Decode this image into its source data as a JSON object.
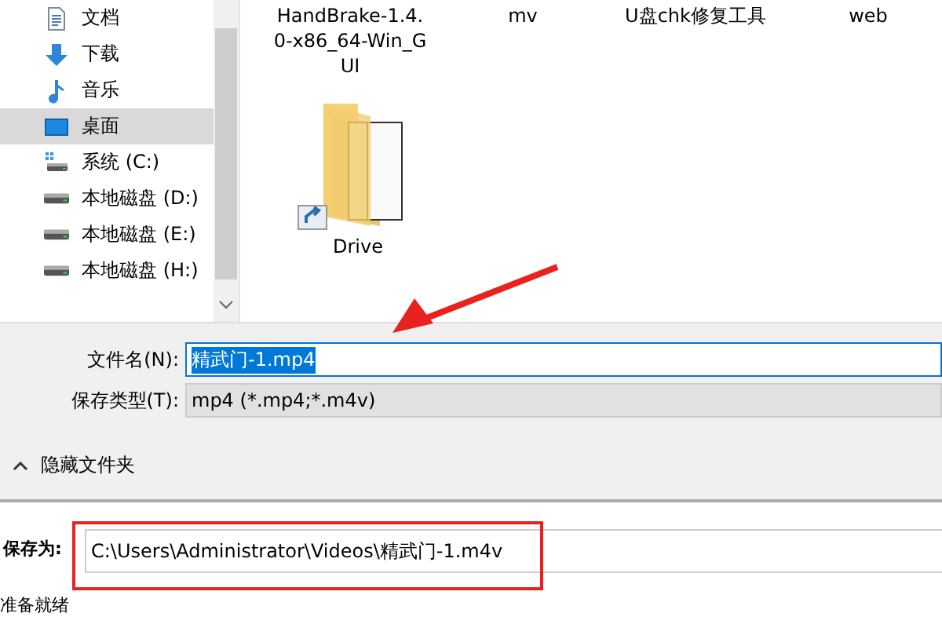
{
  "sidebar": {
    "items": [
      {
        "label": "文档",
        "kind": "document",
        "selected": false
      },
      {
        "label": "下载",
        "kind": "download",
        "selected": false
      },
      {
        "label": "音乐",
        "kind": "music",
        "selected": false
      },
      {
        "label": "桌面",
        "kind": "desktop",
        "selected": true
      },
      {
        "label": "系统 (C:)",
        "kind": "system",
        "selected": false
      },
      {
        "label": "本地磁盘 (D:)",
        "kind": "drive",
        "selected": false
      },
      {
        "label": "本地磁盘 (E:)",
        "kind": "drive",
        "selected": false
      },
      {
        "label": "本地磁盘 (H:)",
        "kind": "drive",
        "selected": false
      }
    ]
  },
  "files": [
    {
      "name": "HandBrake-1.4.0-x86_64-Win_GUI",
      "kind": "name-only"
    },
    {
      "name": "mv",
      "kind": "name-only"
    },
    {
      "name": "U盘chk修复工具",
      "kind": "name-only"
    },
    {
      "name": "web",
      "kind": "name-only"
    },
    {
      "name": "Drive",
      "kind": "folder-shortcut"
    }
  ],
  "form": {
    "file_name_label": "文件名(N):",
    "file_name": "精武门-1.mp4",
    "file_name_selected": true,
    "type_label": "保存类型(T):",
    "type_value": "mp4 (*.mp4;*.m4v)",
    "hide_folders": "隐藏文件夹"
  },
  "save_as": {
    "label": "保存为:",
    "value": "C:\\Users\\Administrator\\Videos\\精武门-1.m4v"
  },
  "status_bar": "准备就绪"
}
